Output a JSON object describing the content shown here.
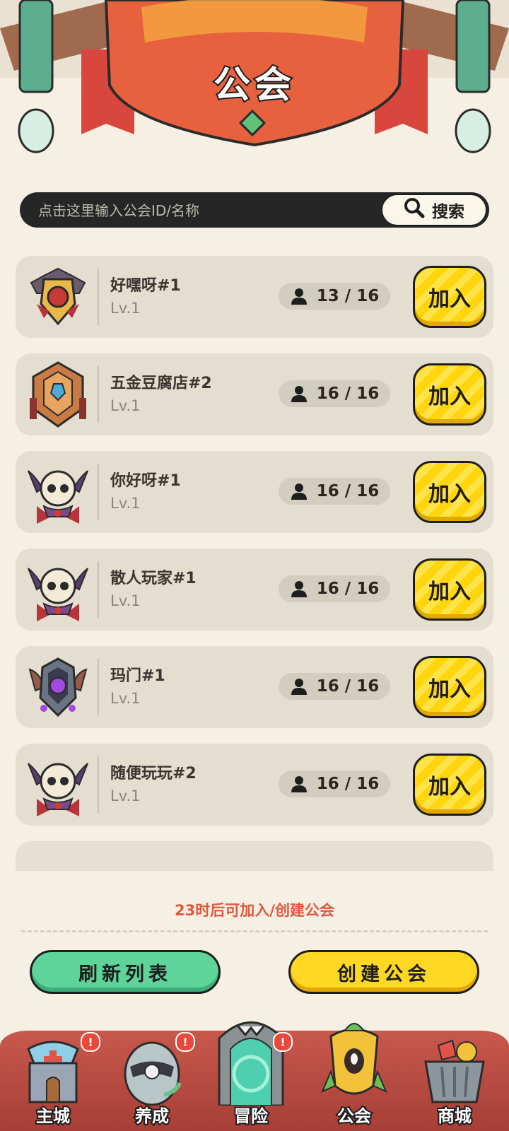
{
  "header": {
    "title": "公会"
  },
  "search": {
    "placeholder": "点击这里输入公会ID/名称",
    "button_label": "搜索"
  },
  "guilds": [
    {
      "name": "好嘿呀#1",
      "level": "Lv.1",
      "members": "13 / 16",
      "join_label": "加入",
      "emblem": "gold-shield-emblem"
    },
    {
      "name": "五金豆腐店#2",
      "level": "Lv.1",
      "members": "16 / 16",
      "join_label": "加入",
      "emblem": "bronze-helmet-emblem"
    },
    {
      "name": "你好呀#1",
      "level": "Lv.1",
      "members": "16 / 16",
      "join_label": "加入",
      "emblem": "skull-emblem"
    },
    {
      "name": "散人玩家#1",
      "level": "Lv.1",
      "members": "16 / 16",
      "join_label": "加入",
      "emblem": "skull-emblem"
    },
    {
      "name": "玛门#1",
      "level": "Lv.1",
      "members": "16 / 16",
      "join_label": "加入",
      "emblem": "purple-gem-emblem"
    },
    {
      "name": "随便玩玩#2",
      "level": "Lv.1",
      "members": "16 / 16",
      "join_label": "加入",
      "emblem": "skull-emblem"
    }
  ],
  "footer": {
    "cooldown_text": "23时后可加入/创建公会",
    "refresh_label": "刷新列表",
    "create_label": "创建公会"
  },
  "tabs": [
    {
      "label": "主城",
      "icon": "castle-icon",
      "badge": "!"
    },
    {
      "label": "养成",
      "icon": "egg-icon",
      "badge": "!"
    },
    {
      "label": "冒险",
      "icon": "portal-icon",
      "badge": "!"
    },
    {
      "label": "公会",
      "icon": "guild-banner-icon",
      "badge": ""
    },
    {
      "label": "商城",
      "icon": "shop-basket-icon",
      "badge": ""
    }
  ],
  "colors": {
    "background": "#f5f0e3",
    "accent_yellow": "#ffd823",
    "accent_green": "#5fd49a",
    "warning_red": "#e0583e",
    "tabbar_red": "#b84a40"
  }
}
